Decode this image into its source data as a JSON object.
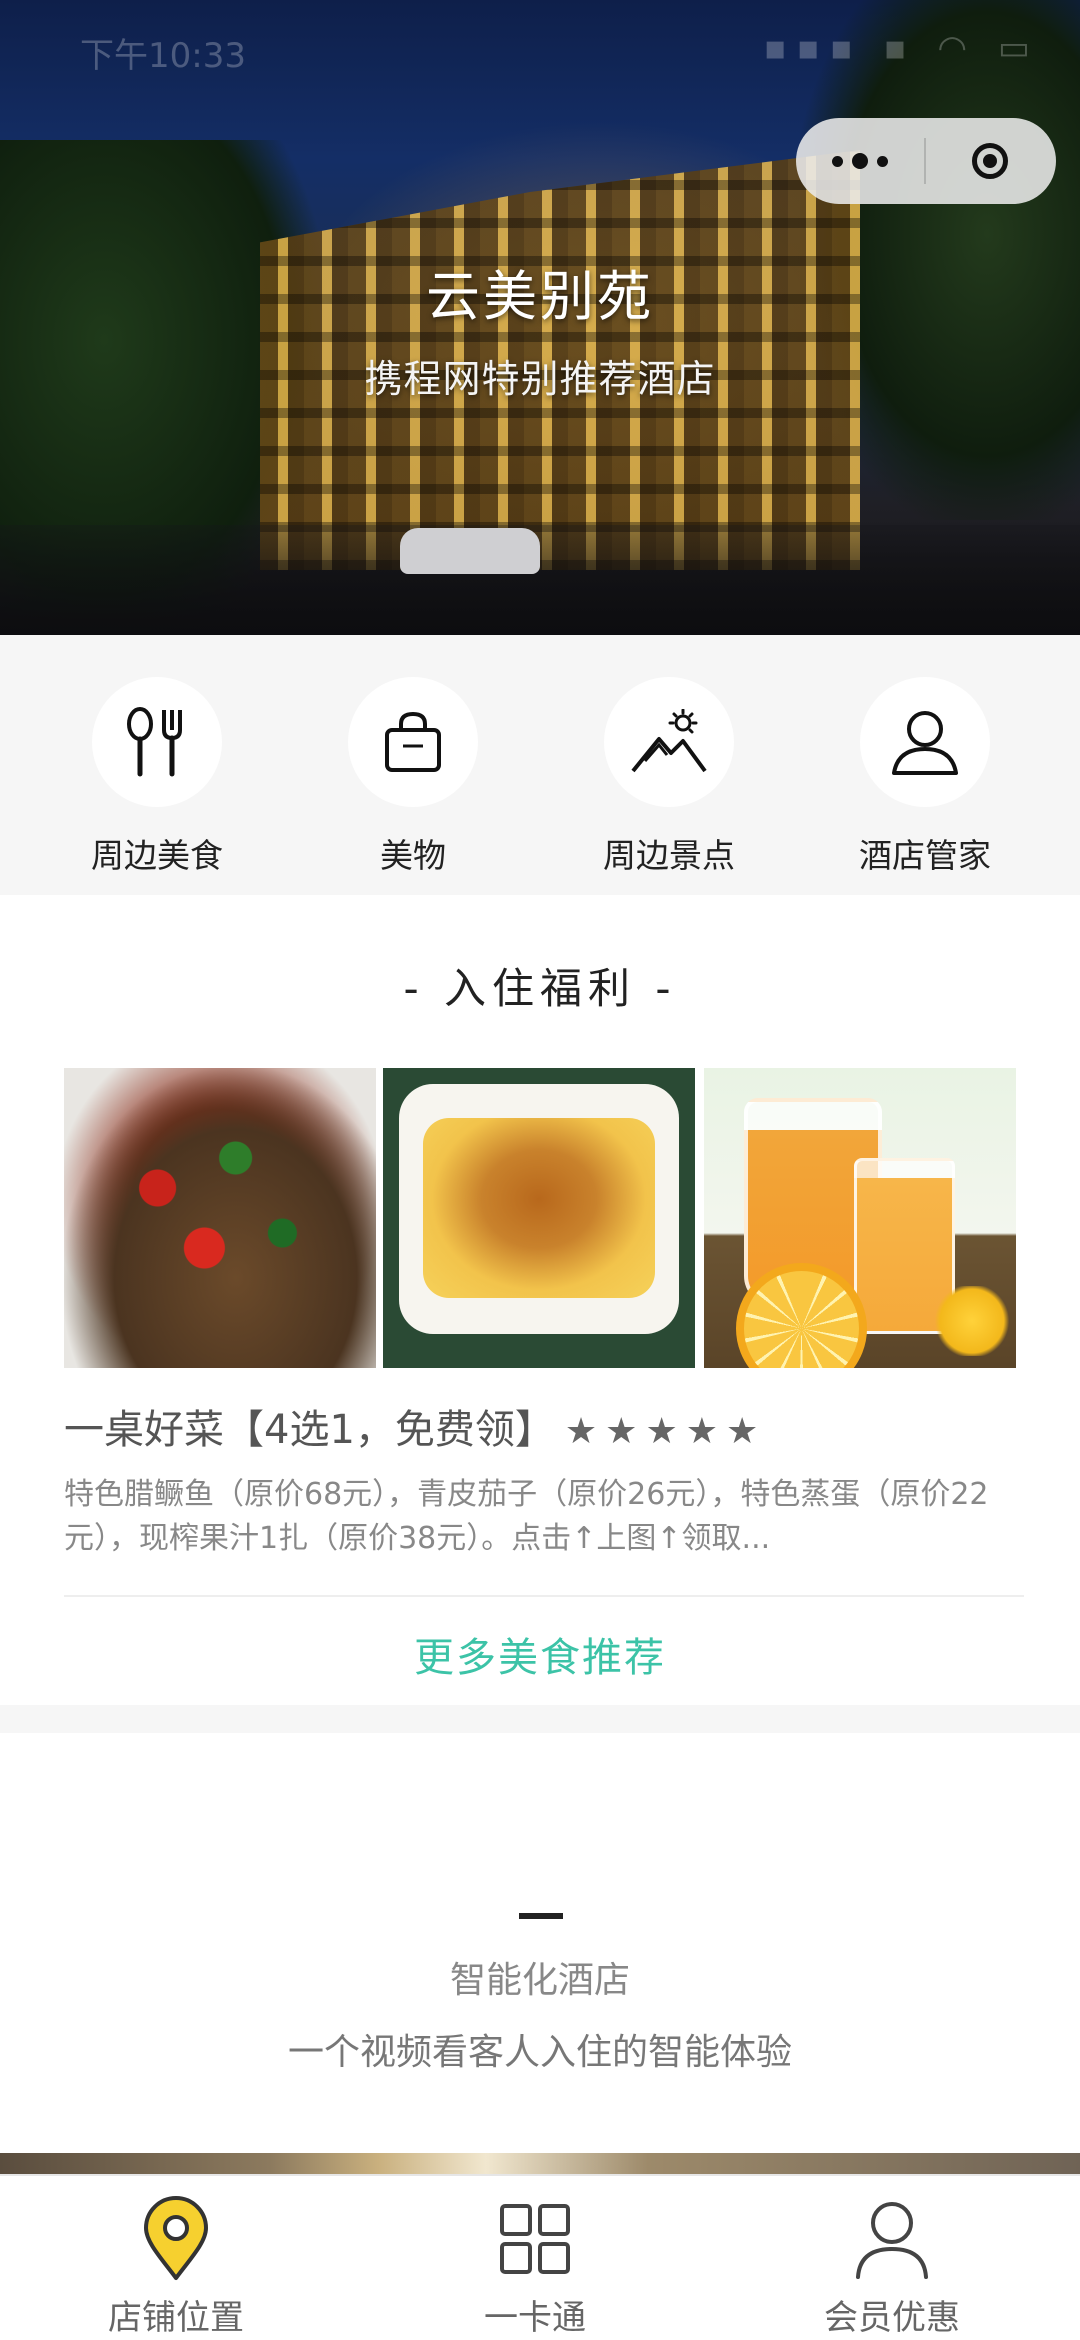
{
  "status_bar": {
    "time": "下午10:33"
  },
  "capsule": {
    "more_icon": "more-dots-icon",
    "close_icon": "target-circle-icon"
  },
  "hero": {
    "title": "云美别苑",
    "subtitle": "携程网特别推荐酒店"
  },
  "quick_nav": {
    "items": [
      {
        "label": "周边美食",
        "icon": "fork-spoon-icon"
      },
      {
        "label": "美物",
        "icon": "shopping-bag-icon"
      },
      {
        "label": "周边景点",
        "icon": "mountain-sun-icon"
      },
      {
        "label": "酒店管家",
        "icon": "person-icon"
      }
    ]
  },
  "benefits": {
    "section_title": "- 入住福利 -",
    "deal_title": "一桌好菜【4选1，免费领】",
    "rating_stars": 5,
    "stars_text": "★★★★★",
    "deal_description": "特色腊鳜鱼（原价68元），青皮茄子（原价26元），特色蒸蛋（原价22元），现榨果汁1扎（原价38元）。点击↑上图↑领取...",
    "more_link": "更多美食推荐"
  },
  "smart_hotel": {
    "title": "智能化酒店",
    "subtitle": "一个视频看客人入住的智能体验"
  },
  "tabbar": {
    "tabs": [
      {
        "label": "店铺位置",
        "icon": "location-pin-icon"
      },
      {
        "label": "一卡通",
        "icon": "grid-icon"
      },
      {
        "label": "会员优惠",
        "icon": "user-icon"
      }
    ]
  },
  "colors": {
    "accent_green": "#3cc3a7",
    "pin_yellow": "#f6d02f",
    "nav_background": "#f6f6f6"
  }
}
